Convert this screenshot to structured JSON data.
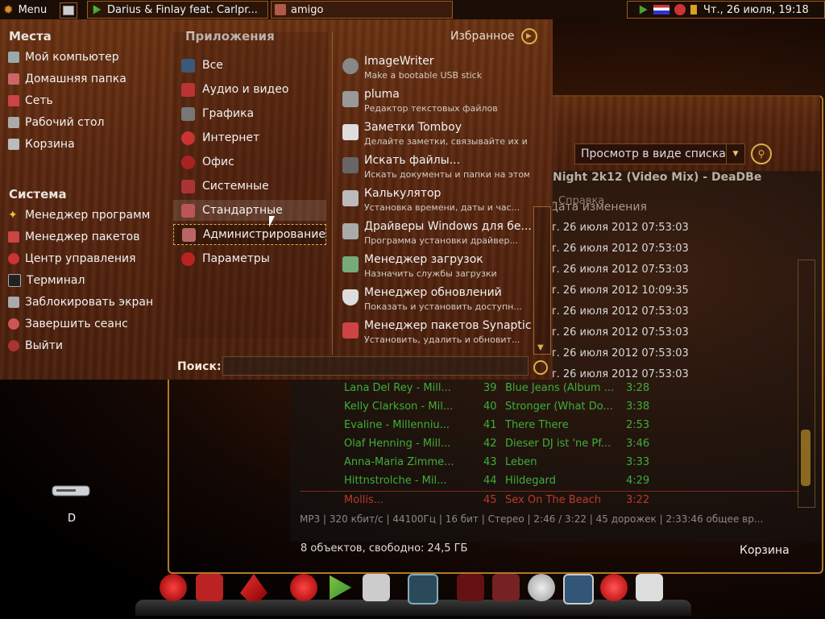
{
  "top_panel": {
    "menu_label": "Menu",
    "tasks": [
      {
        "label": "Darius & Finlay feat. Carlpr..."
      },
      {
        "label": "amigo"
      }
    ],
    "clock": "Чт., 26 июля, 19:18"
  },
  "places": {
    "title": "Места",
    "items": [
      {
        "label": "Мой компьютер",
        "icon": "computer-icon"
      },
      {
        "label": "Домашняя папка",
        "icon": "home-folder-icon"
      },
      {
        "label": "Сеть",
        "icon": "network-icon"
      },
      {
        "label": "Рабочий стол",
        "icon": "desktop-icon"
      },
      {
        "label": "Корзина",
        "icon": "trash-icon"
      }
    ]
  },
  "system": {
    "title": "Система",
    "items": [
      {
        "label": "Менеджер программ",
        "icon": "star-icon"
      },
      {
        "label": "Менеджер пакетов",
        "icon": "package-icon"
      },
      {
        "label": "Центр управления",
        "icon": "control-center-icon"
      },
      {
        "label": "Терминал",
        "icon": "terminal-icon"
      },
      {
        "label": "Заблокировать экран",
        "icon": "lock-icon"
      },
      {
        "label": "Завершить сеанс",
        "icon": "logout-icon"
      },
      {
        "label": "Выйти",
        "icon": "power-icon"
      }
    ]
  },
  "applications": {
    "title": "Приложения",
    "favorites_label": "Избранное",
    "categories": [
      {
        "label": "Все"
      },
      {
        "label": "Аудио и видео"
      },
      {
        "label": "Графика"
      },
      {
        "label": "Интернет"
      },
      {
        "label": "Офис"
      },
      {
        "label": "Системные"
      },
      {
        "label": "Стандартные"
      },
      {
        "label": "Администрирование"
      },
      {
        "label": "Параметры"
      }
    ],
    "items": [
      {
        "name": "ImageWriter",
        "desc": "Make a bootable USB stick"
      },
      {
        "name": "pluma",
        "desc": "Редактор текстовых файлов"
      },
      {
        "name": "Заметки Tomboy",
        "desc": "Делайте заметки, связывайте их и ..."
      },
      {
        "name": "Искать файлы...",
        "desc": "Искать документы и папки на этом ..."
      },
      {
        "name": "Калькулятор",
        "desc": "Установка времени, даты и час..."
      },
      {
        "name": "Драйверы Windows для бе...",
        "desc": "Программа установки драйвер..."
      },
      {
        "name": "Менеджер загрузок",
        "desc": "Назначить службы загрузки"
      },
      {
        "name": "Менеджер обновлений",
        "desc": "Показать и установить доступн..."
      },
      {
        "name": "Менеджер пакетов Synaptic",
        "desc": "Установить, удалить и обновит..."
      }
    ]
  },
  "search": {
    "label": "Поиск:",
    "value": ""
  },
  "background_window": {
    "view_mode": "Просмотр в виде списка",
    "player_title": "Night 2k12 (Video Mix) - DeaDBe",
    "menu_help": "Справка",
    "date_header": "Дата изменения",
    "dates": [
      "т. 26 июля 2012 07:53:03",
      "т. 26 июля 2012 07:53:03",
      "т. 26 июля 2012 07:53:03",
      "т. 26 июля 2012 10:09:35",
      "т. 26 июля 2012 07:53:03",
      "т. 26 июля 2012 07:53:03",
      "т. 26 июля 2012 07:53:03",
      "т. 26 июля 2012 07:53:03"
    ],
    "tracks": [
      {
        "artist": "Lana Del Rey - Mill...",
        "num": "39",
        "title": "Blue Jeans (Album ...",
        "dur": "3:28"
      },
      {
        "artist": "Kelly Clarkson - Mil...",
        "num": "40",
        "title": "Stronger (What Do...",
        "dur": "3:38"
      },
      {
        "artist": "Evaline - Millenniu...",
        "num": "41",
        "title": "There There",
        "dur": "2:53"
      },
      {
        "artist": "Olaf Henning - Mill...",
        "num": "42",
        "title": "Dieser DJ ist 'ne Pf...",
        "dur": "3:46"
      },
      {
        "artist": "Anna-Maria Zimme...",
        "num": "43",
        "title": "Leben",
        "dur": "3:33"
      },
      {
        "artist": "Hittnstrolche - Mil...",
        "num": "44",
        "title": "Hildegard",
        "dur": "4:29"
      },
      {
        "artist": "Mollis...",
        "num": "45",
        "title": "Sex On The Beach",
        "dur": "3:22"
      }
    ],
    "status_line": "MP3 |  320 кбит/с | 44100Гц | 16 бит | Стерео | 2:46 / 3:22 | 45 дорожек | 2:33:46 общее вр...",
    "folder_status": "8 объектов, свободно: 24,5 ГБ",
    "trash_label": "Корзина"
  },
  "desktop": {
    "drive_label": "D"
  },
  "colors": {
    "accent_gold": "#d8b04a",
    "wood_dark": "#4a1f0c",
    "track_green": "#3fae3a",
    "track_red": "#b83a2a"
  }
}
